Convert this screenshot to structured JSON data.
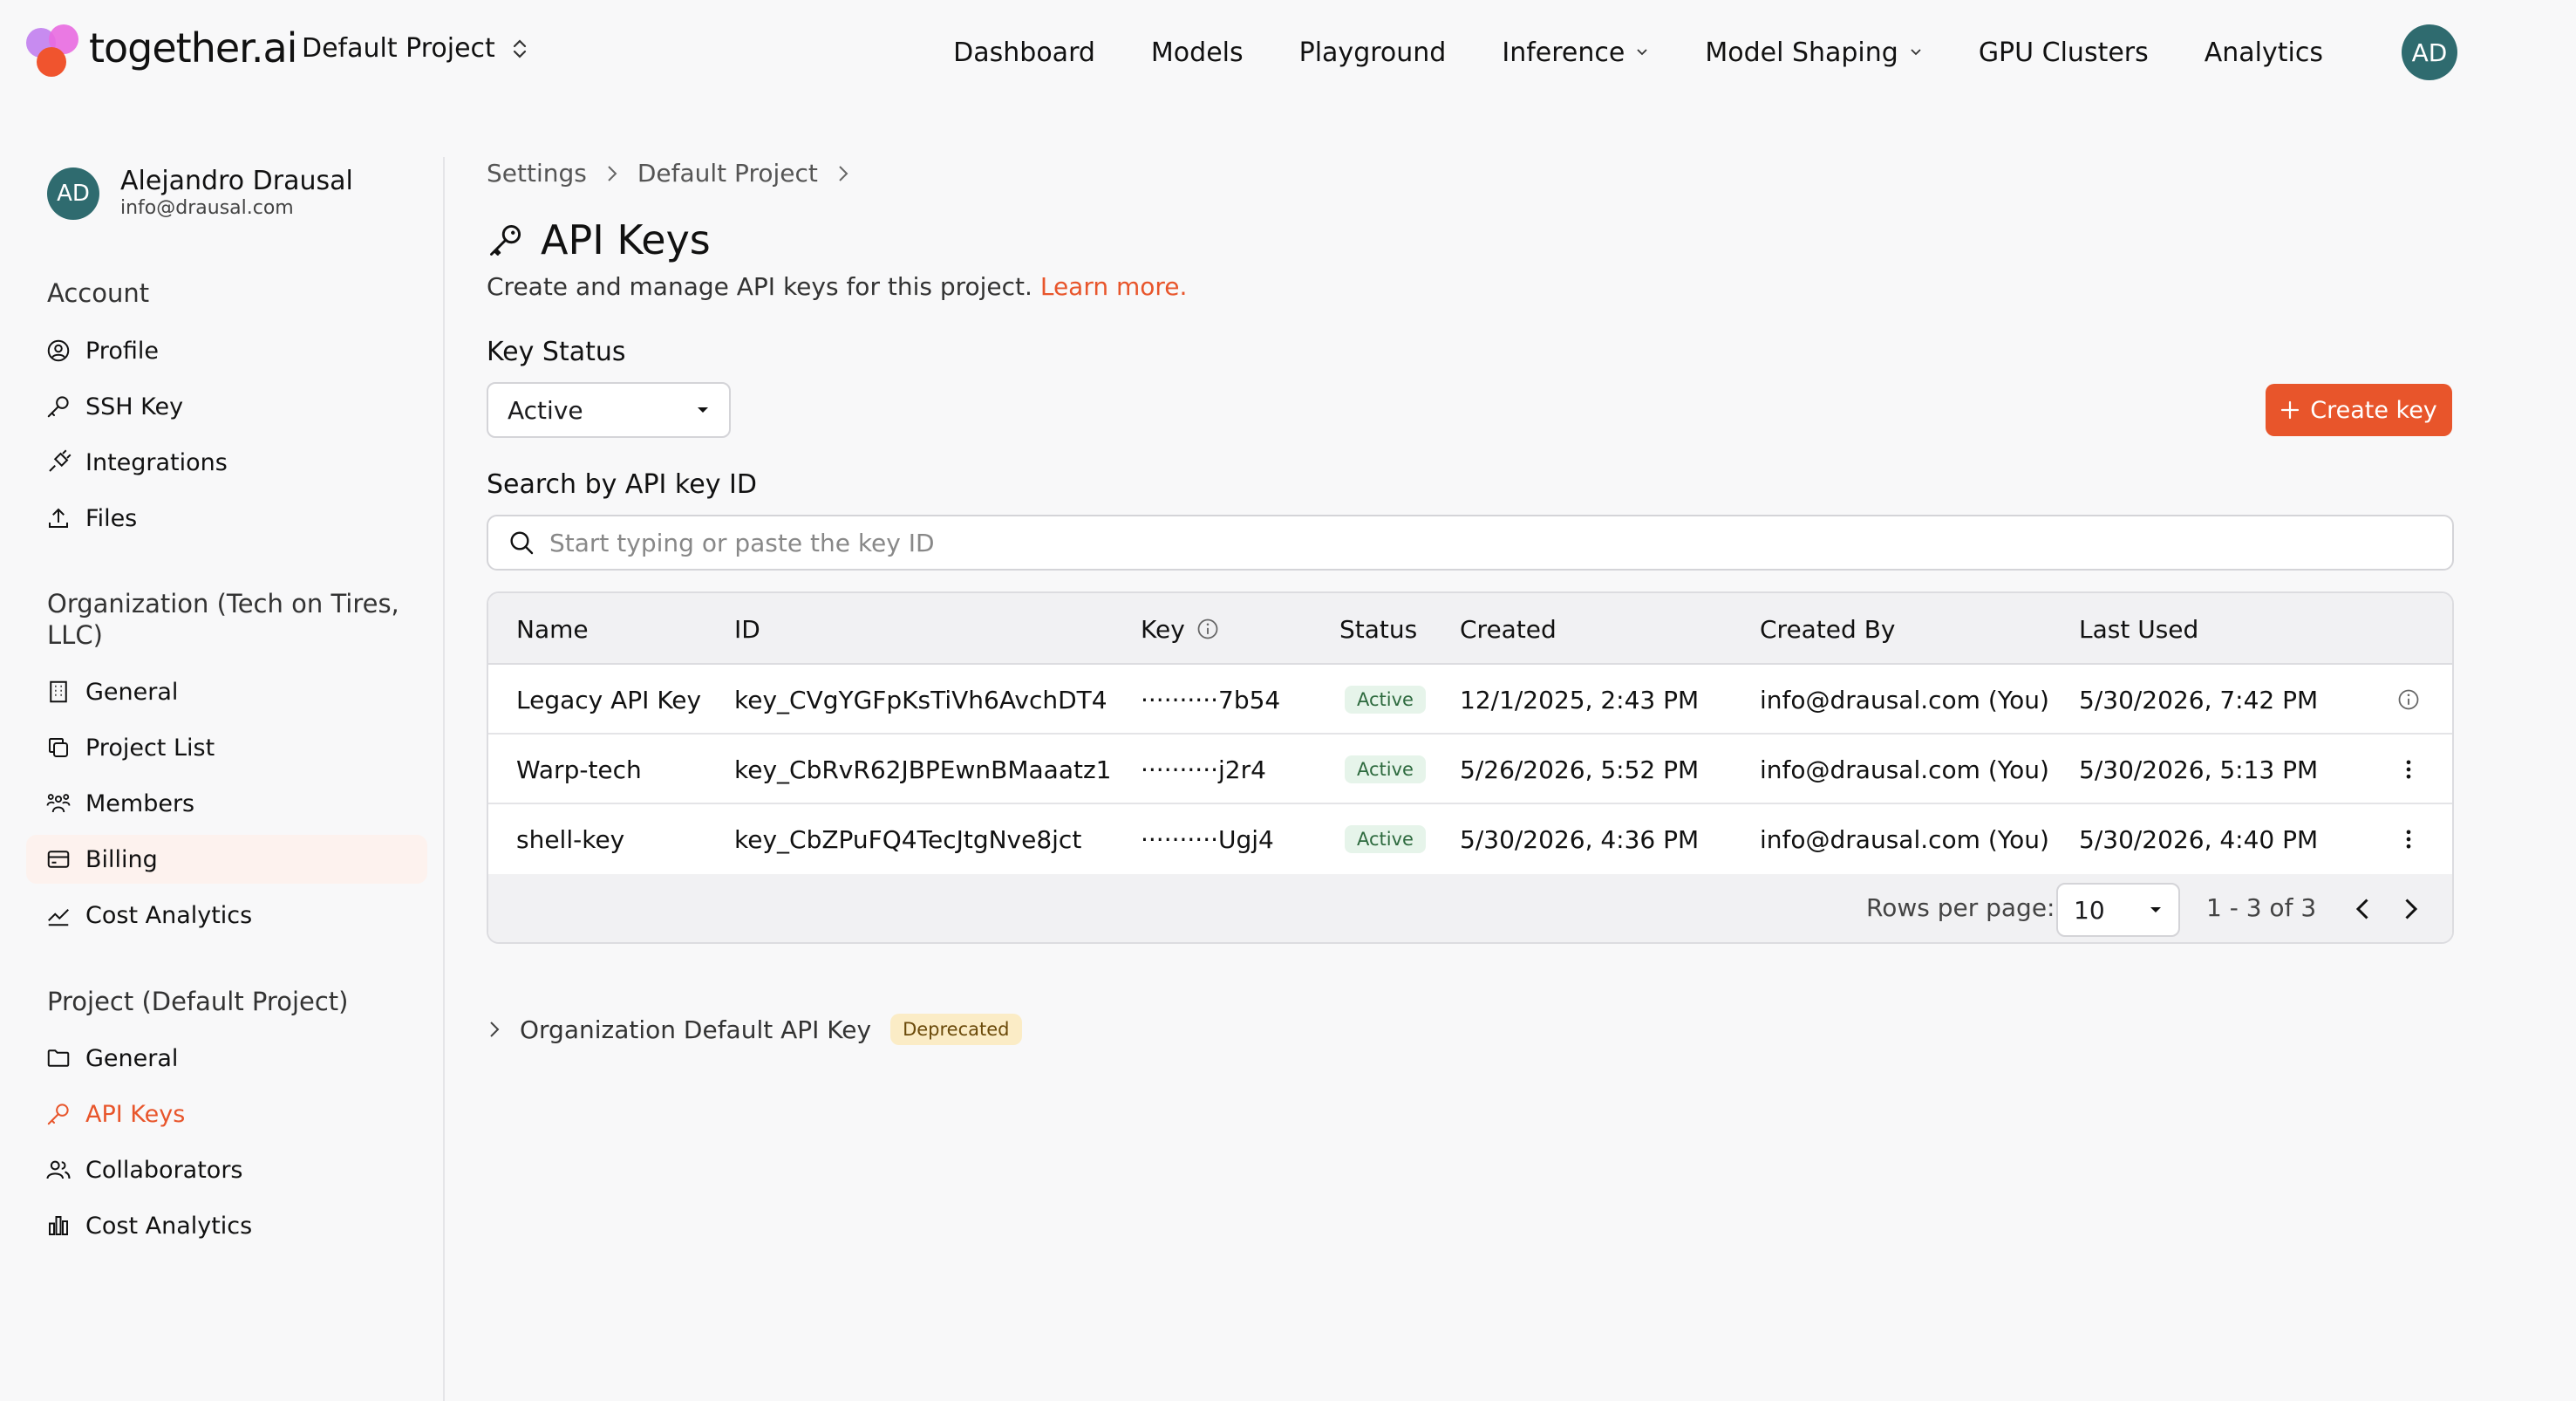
{
  "brand": {
    "name": "together.ai"
  },
  "project_switcher": {
    "label": "Default Project"
  },
  "nav": {
    "items": [
      {
        "label": "Dashboard",
        "dropdown": false
      },
      {
        "label": "Models",
        "dropdown": false
      },
      {
        "label": "Playground",
        "dropdown": false
      },
      {
        "label": "Inference",
        "dropdown": true
      },
      {
        "label": "Model Shaping",
        "dropdown": true
      },
      {
        "label": "GPU Clusters",
        "dropdown": false
      },
      {
        "label": "Analytics",
        "dropdown": false
      }
    ],
    "avatar": "AD"
  },
  "user": {
    "initials": "AD",
    "name": "Alejandro Drausal",
    "email": "info@drausal.com"
  },
  "sidebar": {
    "account_title": "Account",
    "account_items": [
      {
        "label": "Profile",
        "icon": "profile-icon"
      },
      {
        "label": "SSH Key",
        "icon": "key-icon"
      },
      {
        "label": "Integrations",
        "icon": "plug-icon"
      },
      {
        "label": "Files",
        "icon": "upload-icon"
      }
    ],
    "org_title": "Organization (Tech on Tires, LLC)",
    "org_items": [
      {
        "label": "General",
        "icon": "building-icon"
      },
      {
        "label": "Project List",
        "icon": "copy-icon"
      },
      {
        "label": "Members",
        "icon": "members-icon"
      },
      {
        "label": "Billing",
        "icon": "card-icon"
      },
      {
        "label": "Cost Analytics",
        "icon": "trend-icon"
      }
    ],
    "project_title": "Project (Default Project)",
    "project_items": [
      {
        "label": "General",
        "icon": "folder-icon"
      },
      {
        "label": "API Keys",
        "icon": "key-icon"
      },
      {
        "label": "Collaborators",
        "icon": "users-icon"
      },
      {
        "label": "Cost Analytics",
        "icon": "bar-chart-icon"
      }
    ]
  },
  "breadcrumb": [
    "Settings",
    "Default Project"
  ],
  "page": {
    "title": "API Keys",
    "subtitle": "Create and manage API keys for this project.",
    "learn_more": "Learn more."
  },
  "filters": {
    "status_label": "Key Status",
    "status_value": "Active",
    "create_label": "Create key",
    "search_label": "Search by API key ID",
    "search_placeholder": "Start typing or paste the key ID"
  },
  "table": {
    "headers": {
      "name": "Name",
      "id": "ID",
      "key": "Key",
      "status": "Status",
      "created": "Created",
      "created_by": "Created By",
      "last_used": "Last Used"
    },
    "rows": [
      {
        "name": "Legacy API Key",
        "id": "key_CVgYGFpKsTiVh6AvchDT4",
        "key": "··········7b54",
        "status": "Active",
        "created": "12/1/2025, 2:43 PM",
        "created_by": "info@drausal.com (You)",
        "last_used": "5/30/2026, 7:42 PM",
        "action": "info"
      },
      {
        "name": "Warp-tech",
        "id": "key_CbRvR62JBPEwnBMaaatz1",
        "key": "··········j2r4",
        "status": "Active",
        "created": "5/26/2026, 5:52 PM",
        "created_by": "info@drausal.com (You)",
        "last_used": "5/30/2026, 5:13 PM",
        "action": "menu"
      },
      {
        "name": "shell-key",
        "id": "key_CbZPuFQ4TecJtgNve8jct",
        "key": "··········Ugj4",
        "status": "Active",
        "created": "5/30/2026, 4:36 PM",
        "created_by": "info@drausal.com (You)",
        "last_used": "5/30/2026, 4:40 PM",
        "action": "menu"
      }
    ],
    "footer": {
      "rows_label": "Rows per page:",
      "rows_value": "10",
      "range": "1 - 3 of 3"
    }
  },
  "org_default": {
    "label": "Organization Default API Key",
    "badge": "Deprecated"
  },
  "colors": {
    "accent": "#e8552b",
    "avatar": "#2f6b6f",
    "active_badge_bg": "#e6f4ea",
    "deprecated_bg": "#fbecc6"
  }
}
